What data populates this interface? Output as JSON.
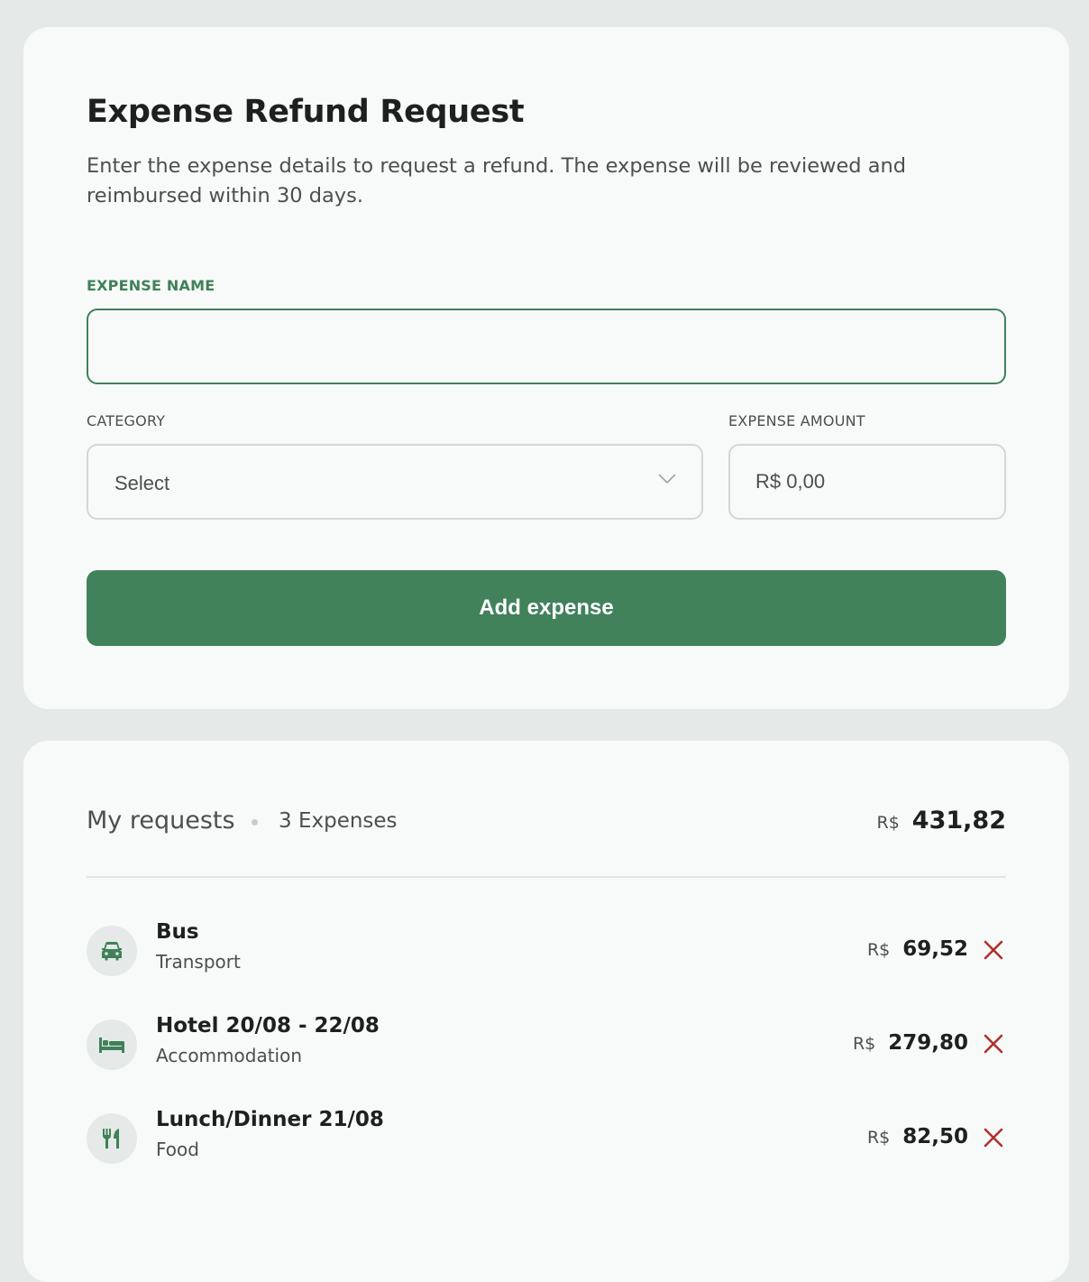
{
  "form": {
    "title": "Expense Refund Request",
    "description": "Enter the expense details to request a refund. The expense will be reviewed and reimbursed within 30 days.",
    "expense_name_label": "EXPENSE NAME",
    "expense_name_value": "",
    "category_label": "CATEGORY",
    "category_value": "Select",
    "amount_label": "EXPENSE AMOUNT",
    "amount_value": "R$ 0,00",
    "submit_label": "Add expense"
  },
  "requests": {
    "title": "My requests",
    "count_label": "3 Expenses",
    "total_currency": "R$",
    "total_value": "431,82",
    "items": [
      {
        "name": "Bus",
        "category": "Transport",
        "currency": "R$",
        "amount": "69,52",
        "icon": "car-icon"
      },
      {
        "name": "Hotel 20/08 - 22/08",
        "category": "Accommodation",
        "currency": "R$",
        "amount": "279,80",
        "icon": "bed-icon"
      },
      {
        "name": "Lunch/Dinner 21/08",
        "category": "Food",
        "currency": "R$",
        "amount": "82,50",
        "icon": "utensils-icon"
      }
    ]
  },
  "colors": {
    "accent": "#41825b",
    "remove": "#b0302b",
    "background": "#e5e9e7",
    "card": "#f8faf9"
  }
}
